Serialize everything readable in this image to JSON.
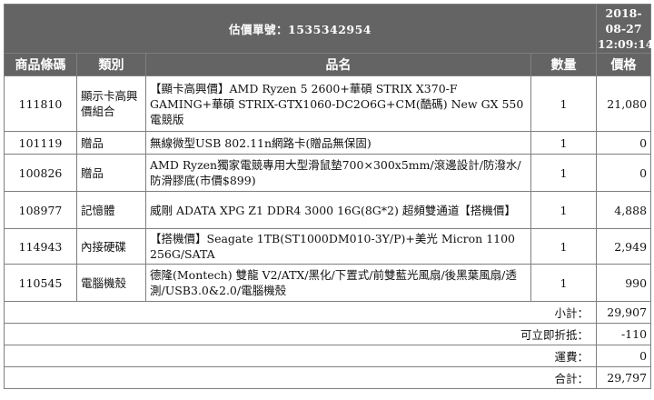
{
  "header": {
    "title": "估價單號：1535342954",
    "date": "2018-08-27",
    "time": "12:09:14"
  },
  "columns": {
    "code": "商品條碼",
    "category": "類別",
    "name": "品名",
    "qty": "數量",
    "price": "價格"
  },
  "items": [
    {
      "code": "111810",
      "category": "顯示卡高興價組合",
      "name": "【顯卡高興價】AMD Ryzen 5 2600+華碩 STRIX X370-F GAMING+華碩 STRIX-GTX1060-DC2O6G+CM(酷碼) New GX 550 電競版",
      "qty": "1",
      "price": "21,080"
    },
    {
      "code": "101119",
      "category": "贈品",
      "name": "無線微型USB 802.11n網路卡(贈品無保固)",
      "qty": "1",
      "price": "0"
    },
    {
      "code": "100826",
      "category": "贈品",
      "name": "AMD Ryzen獨家電競專用大型滑鼠墊700×300x5mm/滾邊設計/防潑水/防滑膠底(市價$899)",
      "qty": "1",
      "price": "0"
    },
    {
      "code": "108977",
      "category": "記憶體",
      "name": "威剛 ADATA XPG Z1 DDR4 3000 16G(8G*2) 超頻雙通道【搭機價】",
      "qty": "1",
      "price": "4,888"
    },
    {
      "code": "114943",
      "category": "內接硬碟",
      "name": "【搭機價】Seagate 1TB(ST1000DM010-3Y/P)+美光 Micron 1100 256G/SATA",
      "qty": "1",
      "price": "2,949"
    },
    {
      "code": "110545",
      "category": "電腦機殼",
      "name": "德隆(Montech) 雙龍 V2/ATX/黑化/下置式/前雙藍光風扇/後黑葉風扇/透測/USB3.0&2.0/電腦機殼",
      "qty": "1",
      "price": "990"
    }
  ],
  "summary": [
    {
      "label": "小計：",
      "value": "29,907"
    },
    {
      "label": "可立即折抵：",
      "value": "-110"
    },
    {
      "label": "運費：",
      "value": "0"
    },
    {
      "label": "合計：",
      "value": "29,797"
    }
  ],
  "colors": {
    "header_bg": "#646464",
    "price_red": "#cc0000",
    "border": "#7f7f7f"
  }
}
